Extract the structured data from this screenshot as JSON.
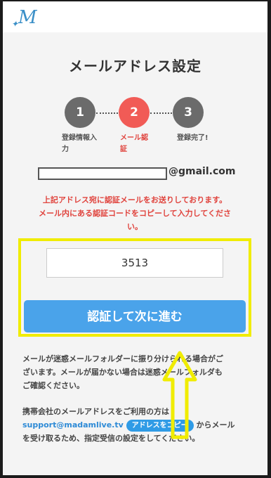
{
  "header": {
    "logo_text": "M"
  },
  "page_title": "メールアドレス設定",
  "steps": [
    {
      "number": "1",
      "label": "登録情報入力",
      "color": "#6b6b6b",
      "status": "done"
    },
    {
      "number": "2",
      "label": "メール認証",
      "color": "#f15b56",
      "status": "current"
    },
    {
      "number": "3",
      "label": "登録完了!",
      "color": "#6b6b6b",
      "status": "todo"
    }
  ],
  "email": {
    "domain": "@gmail.com"
  },
  "notice": {
    "line1": "上記アドレス宛に認証メールをお送りしております。",
    "line2": "メール内にある認証コードをコピーして入力してくださ",
    "line3": "い。"
  },
  "code_input": {
    "value": "3513"
  },
  "submit_button": {
    "label": "認証して次に進む"
  },
  "info": {
    "spam_line1": "メールが迷惑メールフォルダーに振り分けられる場合がご",
    "spam_line2": "ざいます。メールが届かない場合は迷惑メールフォルダも",
    "spam_line3": "ご確認ください。",
    "carrier_line1": "携帯会社のメールアドレスをご利用の方は",
    "support_email": "support@madamlive.tv",
    "copy_button": "アドレスをコピー",
    "carrier_line2_suffix": "からメール",
    "carrier_line3": "を受け取るため、指定受信の設定をしてください。"
  },
  "colors": {
    "accent": "#4aa3ea",
    "alert": "#e0433d",
    "highlight": "#f0ec00"
  }
}
